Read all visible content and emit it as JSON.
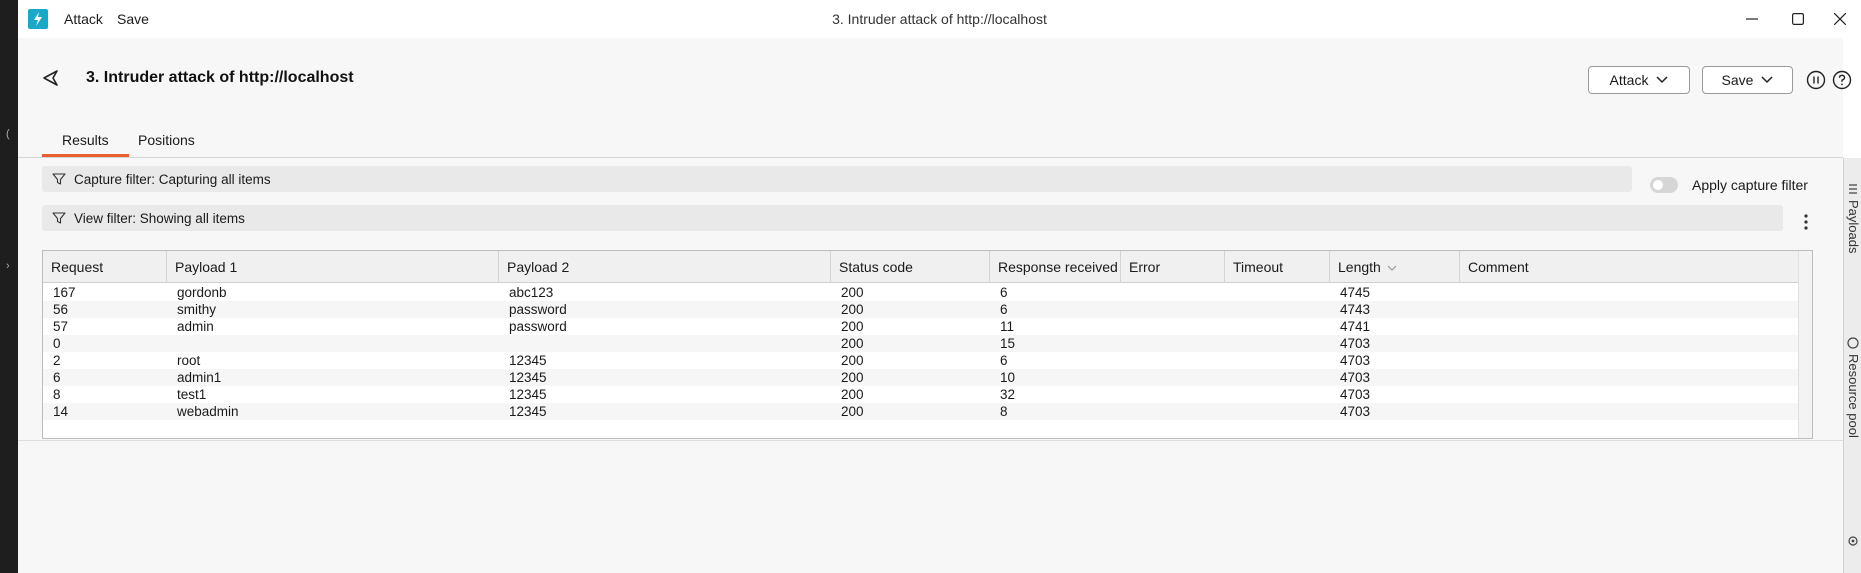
{
  "app": {
    "menu": [
      "Attack",
      "Save"
    ],
    "window_title": "3. Intruder attack of http://localhost",
    "accent_color": "#e8602c",
    "logo_color": "#1aa8c8"
  },
  "header": {
    "title": "3. Intruder attack of http://localhost",
    "attack_button": "Attack",
    "save_button": "Save"
  },
  "tabs": [
    {
      "label": "Results",
      "active": true
    },
    {
      "label": "Positions",
      "active": false
    }
  ],
  "filters": {
    "capture": "Capture filter: Capturing all items",
    "view": "View filter: Showing all items",
    "apply_capture_label": "Apply capture filter",
    "apply_capture_enabled": false
  },
  "table": {
    "columns": [
      "Request",
      "Payload 1",
      "Payload 2",
      "Status code",
      "Response received",
      "Error",
      "Timeout",
      "Length",
      "Comment"
    ],
    "sort_column": "Length",
    "rows": [
      [
        "167",
        "gordonb",
        "abc123",
        "200",
        "6",
        "",
        "",
        "4745",
        ""
      ],
      [
        "56",
        "smithy",
        "password",
        "200",
        "6",
        "",
        "",
        "4743",
        ""
      ],
      [
        "57",
        "admin",
        "password",
        "200",
        "11",
        "",
        "",
        "4741",
        ""
      ],
      [
        "0",
        "",
        "",
        "200",
        "15",
        "",
        "",
        "4703",
        ""
      ],
      [
        "2",
        "root",
        "12345",
        "200",
        "6",
        "",
        "",
        "4703",
        ""
      ],
      [
        "6",
        "admin1",
        "12345",
        "200",
        "10",
        "",
        "",
        "4703",
        ""
      ],
      [
        "8",
        "test1",
        "12345",
        "200",
        "32",
        "",
        "",
        "4703",
        ""
      ],
      [
        "14",
        "webadmin",
        "12345",
        "200",
        "8",
        "",
        "",
        "4703",
        ""
      ]
    ]
  },
  "right_rail": {
    "items": [
      "Payloads",
      "Resource pool"
    ]
  }
}
